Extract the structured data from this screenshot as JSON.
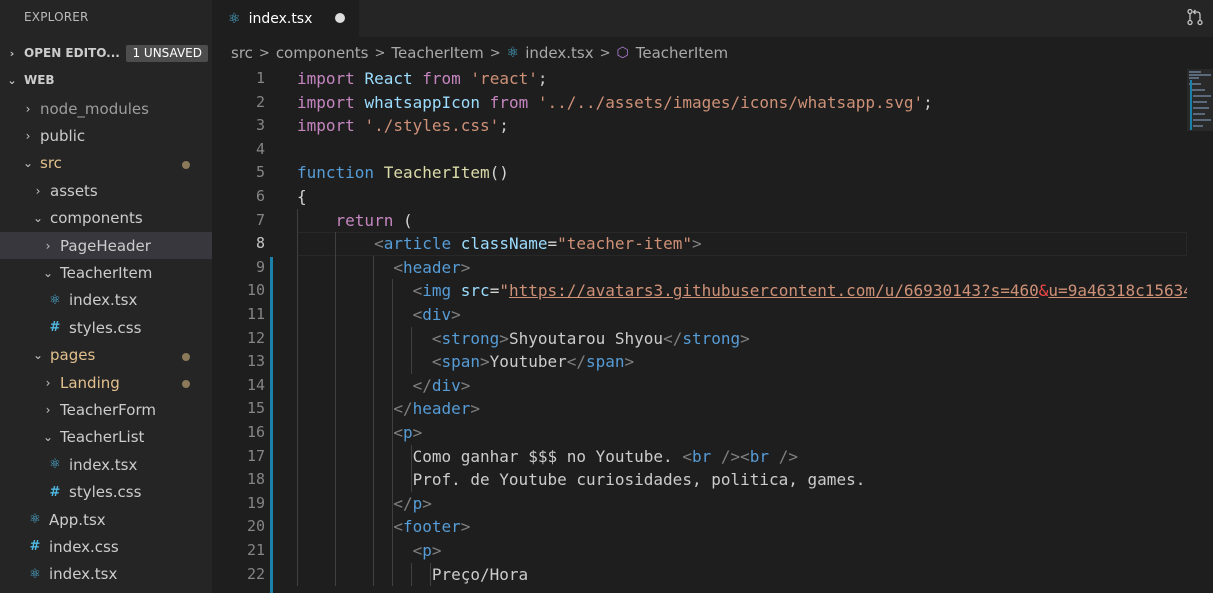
{
  "sidebar": {
    "title": "EXPLORER",
    "open_editors": {
      "label": "OPEN EDITO...",
      "badge": "1 UNSAVED",
      "chevron": ">"
    },
    "workspace": {
      "label": "WEB",
      "chevron": "v"
    },
    "tree": [
      {
        "label": "node_modules",
        "chevron": ">",
        "icon": "none"
      },
      {
        "label": "public",
        "chevron": ">",
        "icon": "none"
      },
      {
        "label": "src",
        "chevron": "v",
        "icon": "none"
      },
      {
        "label": "assets",
        "chevron": ">",
        "icon": "none"
      },
      {
        "label": "components",
        "chevron": "v",
        "icon": "none"
      },
      {
        "label": "PageHeader",
        "chevron": ">",
        "icon": "none"
      },
      {
        "label": "TeacherItem",
        "chevron": "v",
        "icon": "none"
      },
      {
        "label": "index.tsx",
        "icon": "react-icon"
      },
      {
        "label": "styles.css",
        "icon": "hash-icon",
        "glyph": "#"
      },
      {
        "label": "pages",
        "chevron": "v",
        "icon": "none"
      },
      {
        "label": "Landing",
        "chevron": ">",
        "icon": "none"
      },
      {
        "label": "TeacherForm",
        "chevron": ">",
        "icon": "none"
      },
      {
        "label": "TeacherList",
        "chevron": "v",
        "icon": "none"
      },
      {
        "label": "index.tsx",
        "icon": "react-icon"
      },
      {
        "label": "styles.css",
        "icon": "hash-icon",
        "glyph": "#"
      },
      {
        "label": "App.tsx",
        "icon": "react-icon"
      },
      {
        "label": "index.css",
        "icon": "hash-icon",
        "glyph": "#"
      },
      {
        "label": "index.tsx",
        "icon": "react-icon"
      }
    ]
  },
  "tabs": [
    {
      "label": "index.tsx",
      "dirty": true,
      "icon": "react-icon"
    }
  ],
  "actions": {
    "source_control_icon": "source-control-icon"
  },
  "breadcrumb": [
    "src",
    "components",
    "TeacherItem",
    "index.tsx",
    "TeacherItem"
  ],
  "breadcrumb_sep": ">",
  "editor": {
    "line_numbers": [
      "1",
      "2",
      "3",
      "4",
      "5",
      "6",
      "7",
      "8",
      "9",
      "10",
      "11",
      "12",
      "13",
      "14",
      "15",
      "16",
      "17",
      "18",
      "19",
      "20",
      "21",
      "22"
    ],
    "lines": [
      "import React from 'react';",
      "import whatsappIcon from '../../assets/images/icons/whatsapp.svg';",
      "import './styles.css';",
      "",
      "function TeacherItem()",
      "{",
      "    return (",
      "        <article className=\"teacher-item\">",
      "          <header>",
      "            <img src=\"https://avatars3.githubusercontent.com/u/66930143?s=460&u=9a46318c15634",
      "            <div>",
      "              <strong>Shyoutarou Shyou</strong>",
      "              <span>Youtuber</span>",
      "            </div>",
      "          </header>",
      "          <p>",
      "            Como ganhar $$$ no Youtube. <br /><br />",
      "            Prof. de Youtube curiosidades, politica, games.",
      "          </p>",
      "          <footer>",
      "            <p>",
      "              Preço/Hora"
    ]
  },
  "colors": {
    "keyword": "#569cd6",
    "control": "#c586c0",
    "string": "#ce9178",
    "variable": "#9cdcfe",
    "function": "#dcdcaa",
    "modified_gutter": "#1b81a8"
  }
}
